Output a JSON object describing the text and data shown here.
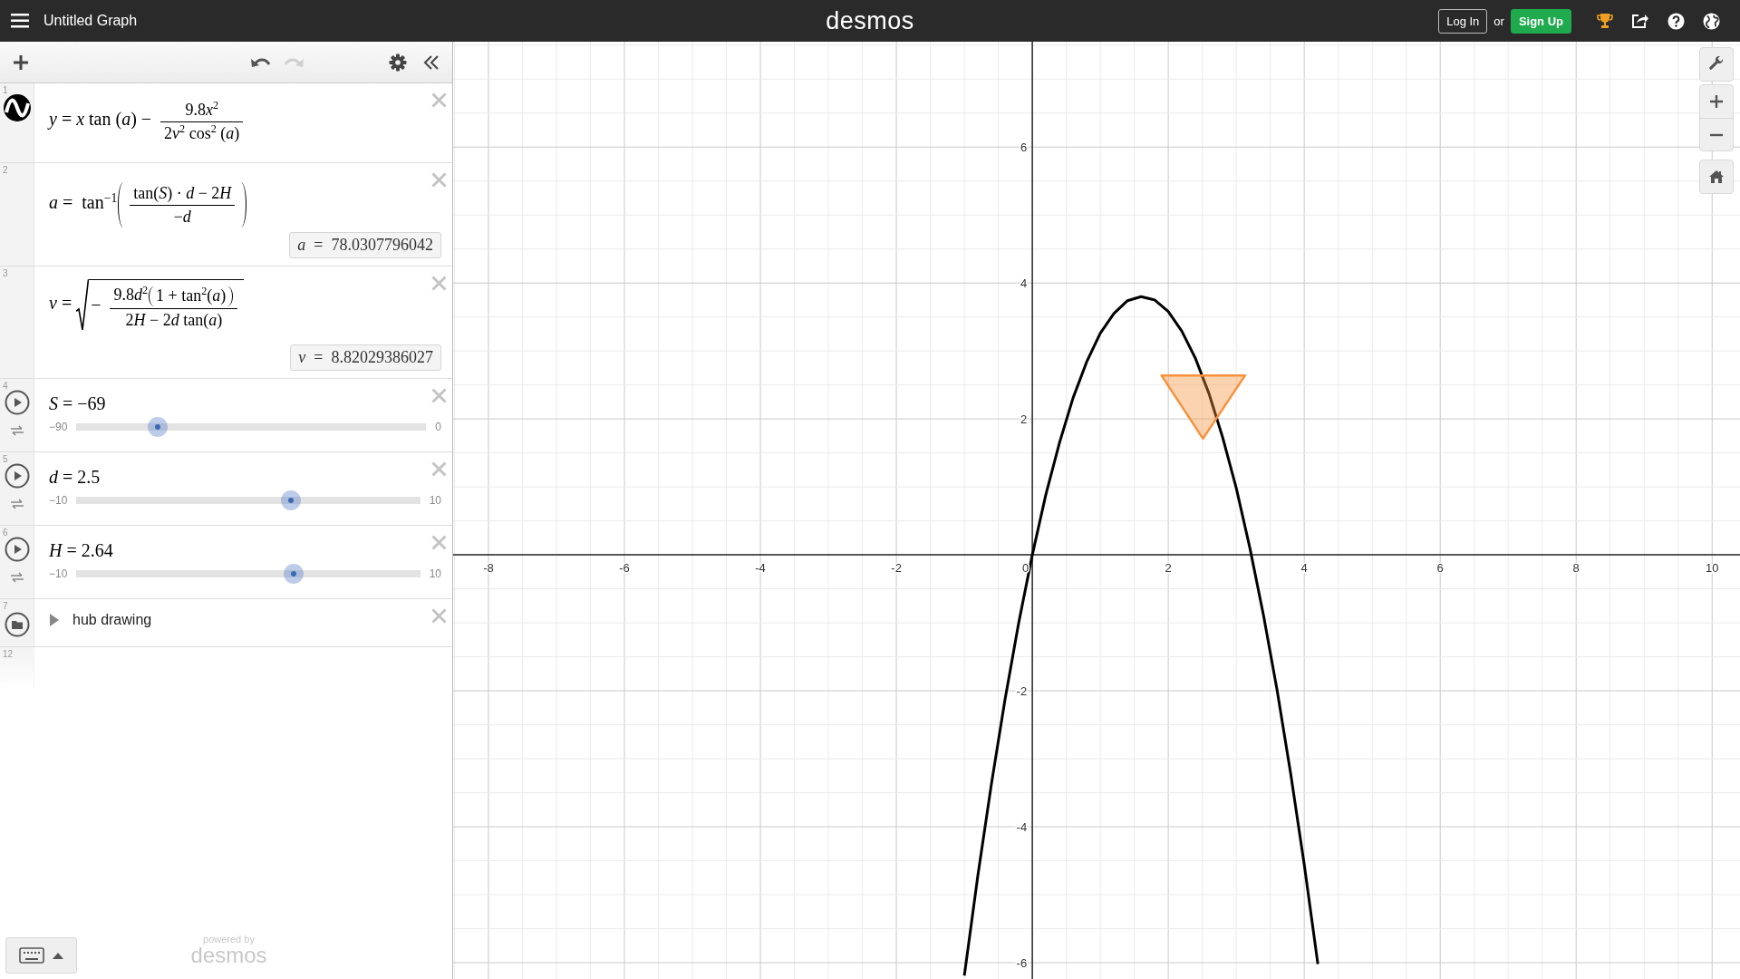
{
  "top_bar": {
    "title": "Untitled Graph",
    "logo": "desmos",
    "login_button": "Log In",
    "separator": "or",
    "signup_button": "Sign Up"
  },
  "toolbar": {
    "undo": {
      "disabled": false
    },
    "redo": {
      "disabled": true
    }
  },
  "expressions": [
    {
      "kind": "function",
      "index": "1",
      "math": [
        {
          "var": "y"
        },
        " = ",
        {
          "var": "x"
        },
        " tan (",
        {
          "var": "a"
        },
        ") − ",
        {
          "frac": [
            [
              "9.8",
              {
                "var": "x"
              },
              {
                "sup": [
                  "2"
                ]
              }
            ],
            [
              "2",
              {
                "var": "v"
              },
              {
                "sup": [
                  "2"
                ]
              },
              " cos",
              {
                "sup": [
                  "2"
                ]
              },
              " (",
              {
                "var": "a"
              },
              ")"
            ]
          ]
        }
      ]
    },
    {
      "kind": "definition",
      "index": "2",
      "math": [
        {
          "var": "a"
        },
        " =  tan",
        {
          "sup": [
            "−1"
          ]
        },
        {
          "paren": [
            {
              "frac": [
                [
                  "tan(",
                  {
                    "var": "S"
                  },
                  ") · ",
                  {
                    "var": "d"
                  },
                  " − 2",
                  {
                    "var": "H"
                  }
                ],
                [
                  "−",
                  {
                    "var": "d"
                  }
                ]
              ]
            }
          ]
        }
      ],
      "result": "*a*  =  78.0307796042"
    },
    {
      "kind": "definition",
      "index": "3",
      "math": [
        {
          "var": "v"
        },
        " = ",
        {
          "sqrt": [
            "− ",
            {
              "frac": [
                [
                  "9.8",
                  {
                    "var": "d"
                  },
                  {
                    "sup": [
                      "2"
                    ]
                  },
                  {
                    "paren": [
                      "1 + tan",
                      {
                        "sup": [
                          "2"
                        ]
                      },
                      "(",
                      {
                        "var": "a"
                      },
                      ")"
                    ]
                  }
                ],
                [
                  "2",
                  {
                    "var": "H"
                  },
                  " − 2",
                  {
                    "var": "d"
                  },
                  " tan(",
                  {
                    "var": "a"
                  },
                  ")"
                ]
              ]
            }
          ]
        }
      ],
      "result": "*v*  =  8.82029386027"
    },
    {
      "kind": "slider",
      "index": "4",
      "math": [
        {
          "var": "S"
        },
        " = −69"
      ],
      "min": "−90",
      "max": "0",
      "level": 0.233
    },
    {
      "kind": "slider",
      "index": "5",
      "math": [
        {
          "var": "d"
        },
        " = 2.5"
      ],
      "min": "−10",
      "max": "10",
      "level": 0.625
    },
    {
      "kind": "slider",
      "index": "6",
      "math": [
        {
          "var": "H"
        },
        " = 2.64"
      ],
      "min": "−10",
      "max": "10",
      "level": 0.632
    },
    {
      "kind": "folder",
      "index": "7",
      "label": "hub drawing",
      "expanded": false
    },
    {
      "kind": "empty",
      "index": "12"
    }
  ],
  "footer": {
    "powered_by": "powered by",
    "logo": "desmos"
  },
  "graph": {
    "shapes": [
      {
        "kind": "triangle"
      }
    ],
    "chart_data": {
      "type": "line",
      "grid": true,
      "x": [
        -1.0,
        -0.8,
        -0.6,
        -0.4,
        -0.2,
        0,
        0.2,
        0.4,
        0.6,
        0.8,
        1.0,
        1.2,
        1.4,
        1.6,
        1.8,
        2.0,
        2.2,
        2.4,
        2.6,
        2.8,
        3.0,
        3.2,
        3.4,
        3.6,
        3.8,
        4.0,
        4.2
      ],
      "series": [
        {
          "color": "#000000",
          "values": [
            -6.19,
            -4.71,
            -3.36,
            -2.12,
            -1.0,
            0,
            0.89,
            1.65,
            2.31,
            2.84,
            3.26,
            3.55,
            3.74,
            3.8,
            3.75,
            3.58,
            3.29,
            2.89,
            2.37,
            1.73,
            0.98,
            0.1,
            -0.89,
            -1.99,
            -3.22,
            -4.56,
            -6.02
          ]
        }
      ],
      "xlim": [
        -8.52,
        10.41
      ],
      "ylim": [
        -6.24,
        7.55
      ],
      "xticks": [
        {
          "value": -8,
          "label": "-8"
        },
        {
          "value": -6,
          "label": "-6"
        },
        {
          "value": -4,
          "label": "-4"
        },
        {
          "value": -2,
          "label": "-2"
        },
        {
          "value": 0,
          "label": "0"
        },
        {
          "value": 2,
          "label": "2"
        },
        {
          "value": 4,
          "label": "4"
        },
        {
          "value": 6,
          "label": "6"
        },
        {
          "value": 8,
          "label": "8"
        },
        {
          "value": 10,
          "label": "10"
        }
      ],
      "yticks": [
        {
          "value": -6,
          "label": "-6"
        },
        {
          "value": -4,
          "label": "-4"
        },
        {
          "value": -2,
          "label": "-2"
        },
        {
          "value": 2,
          "label": "2"
        },
        {
          "value": 4,
          "label": "4"
        },
        {
          "value": 6,
          "label": "6"
        }
      ]
    }
  }
}
